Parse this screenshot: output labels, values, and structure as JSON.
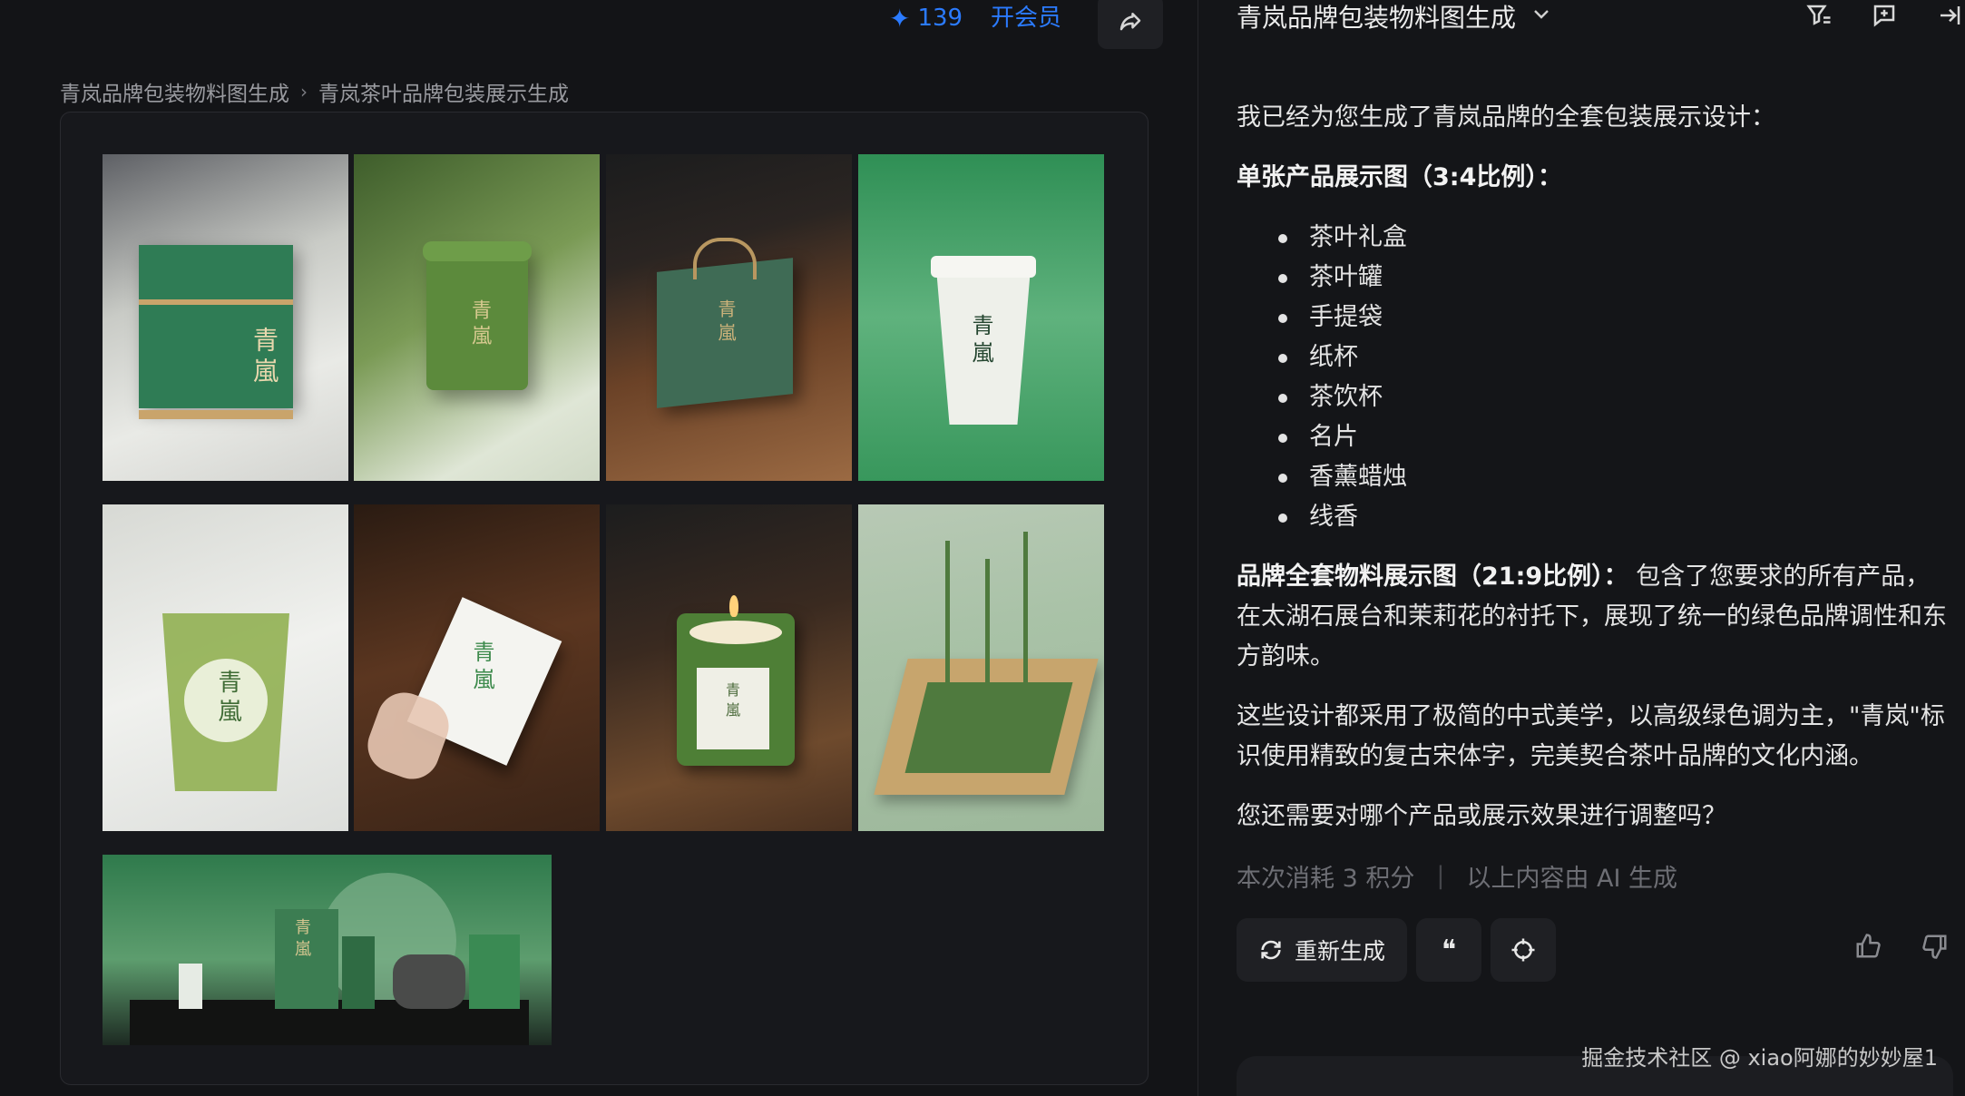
{
  "header": {
    "credits": "139",
    "vip_label": "开会员",
    "share_icon": "share-icon"
  },
  "breadcrumb": {
    "parent": "青岚品牌包装物料图生成",
    "separator": "›",
    "current": "青岚茶叶品牌包装展示生成"
  },
  "gallery": {
    "tiles": [
      {
        "caption": "青嵐"
      },
      {
        "caption": "青嵐"
      },
      {
        "caption": "青嵐"
      },
      {
        "caption": "青嵐"
      },
      {
        "caption": "青嵐"
      },
      {
        "caption": "青嵐"
      },
      {
        "caption": "青嵐"
      },
      {
        "caption": ""
      },
      {
        "caption": "青嵐"
      }
    ]
  },
  "panel": {
    "title": "青岚品牌包装物料图生成",
    "icons": [
      "filter-icon",
      "new-chat-icon",
      "collapse-icon"
    ]
  },
  "message": {
    "intro": "我已经为您生成了青岚品牌的全套包装展示设计：",
    "single_heading": "单张产品展示图（3:4比例）：",
    "items": [
      "茶叶礼盒",
      "茶叶罐",
      "手提袋",
      "纸杯",
      "茶饮杯",
      "名片",
      "香薰蜡烛",
      "线香"
    ],
    "full_heading": "品牌全套物料展示图（21:9比例）：",
    "full_text": " 包含了您要求的所有产品，在太湖石展台和茉莉花的衬托下，展现了统一的绿色品牌调性和东方韵味。",
    "para2": "这些设计都采用了极简的中式美学，以高级绿色调为主，\"青岚\"标识使用精致的复古宋体字，完美契合茶叶品牌的文化内涵。",
    "question": "您还需要对哪个产品或展示效果进行调整吗？",
    "cost": "本次消耗 3 积分",
    "ai_note": "以上内容由 AI 生成"
  },
  "actions": {
    "regenerate": "重新生成",
    "quote_glyph": "❝",
    "target_glyph": "⌖"
  },
  "watermark": "掘金技术社区 @ xiao阿娜的妙妙屋1"
}
